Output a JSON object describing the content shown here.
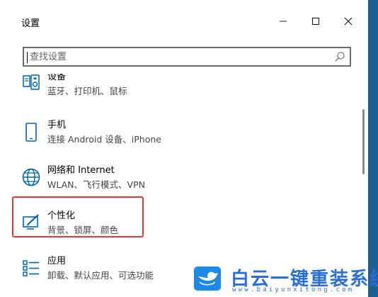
{
  "window": {
    "title": "设置"
  },
  "search": {
    "placeholder": "查找设置"
  },
  "items": [
    {
      "name": "设备",
      "desc": "蓝牙、打印机、鼠标"
    },
    {
      "name": "手机",
      "desc": "连接 Android 设备、iPhone"
    },
    {
      "name": "网络和 Internet",
      "desc": "WLAN、飞行模式、VPN"
    },
    {
      "name": "个性化",
      "desc": "背景、锁屏、颜色"
    },
    {
      "name": "应用",
      "desc": "卸载、默认应用、可选功能"
    }
  ],
  "watermark": {
    "brand": "白云一键重装系统",
    "url": "www.baiyunxitong.com"
  },
  "colors": {
    "accent": "#0063b1",
    "highlight": "#e53935",
    "watermark": "#2a6fd6"
  },
  "icons": [
    "device-icon",
    "phone-icon",
    "globe-icon",
    "personalization-icon",
    "apps-icon",
    "search-icon"
  ]
}
